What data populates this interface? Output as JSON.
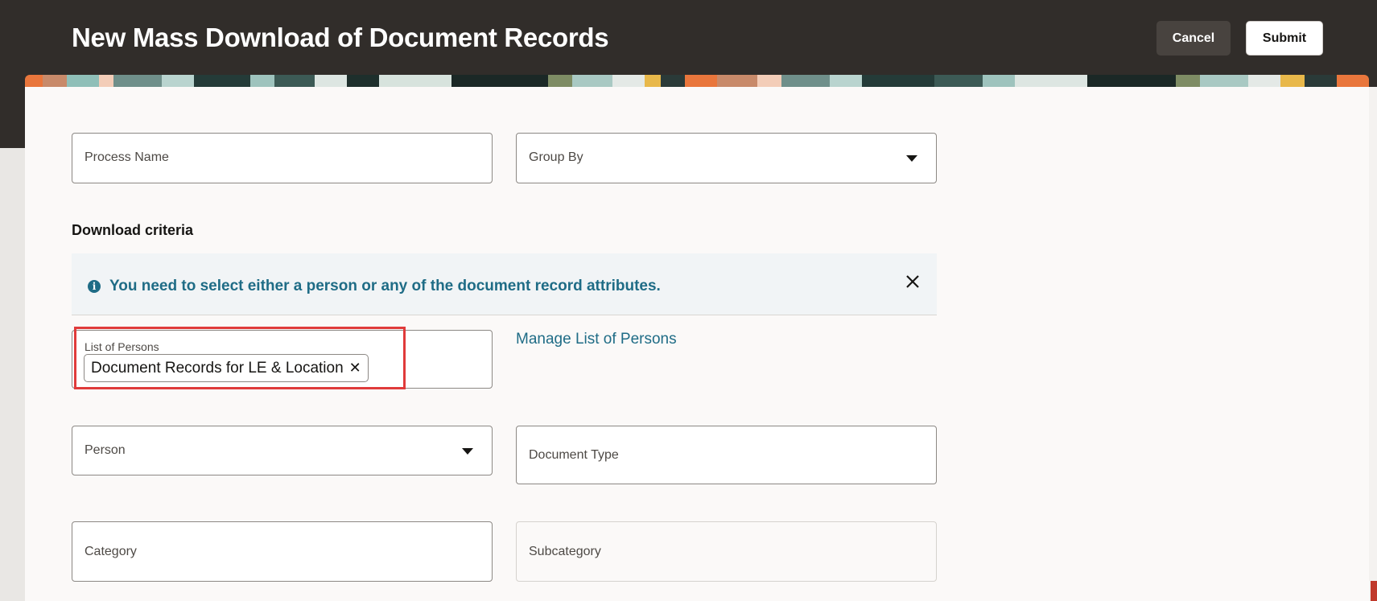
{
  "header": {
    "title": "New Mass Download of Document Records",
    "cancel_label": "Cancel",
    "submit_label": "Submit"
  },
  "form": {
    "process_name_label": "Process Name",
    "group_by_label": "Group By",
    "section_title": "Download criteria",
    "info_message": "You need to select either a person or any of the document record attributes.",
    "list_of_persons_label": "List of Persons",
    "list_of_persons_chip": "Document Records for LE & Location",
    "manage_link": "Manage List of Persons",
    "person_label": "Person",
    "document_type_label": "Document Type",
    "category_label": "Category",
    "subcategory_label": "Subcategory"
  },
  "icons": {
    "info": "info-circle-icon",
    "close": "close-icon",
    "dropdown": "chevron-down-icon",
    "chip_remove": "remove-icon"
  },
  "colors": {
    "header_bg": "#312d2a",
    "accent_link": "#1f6c86",
    "highlight": "#e03b3b"
  }
}
